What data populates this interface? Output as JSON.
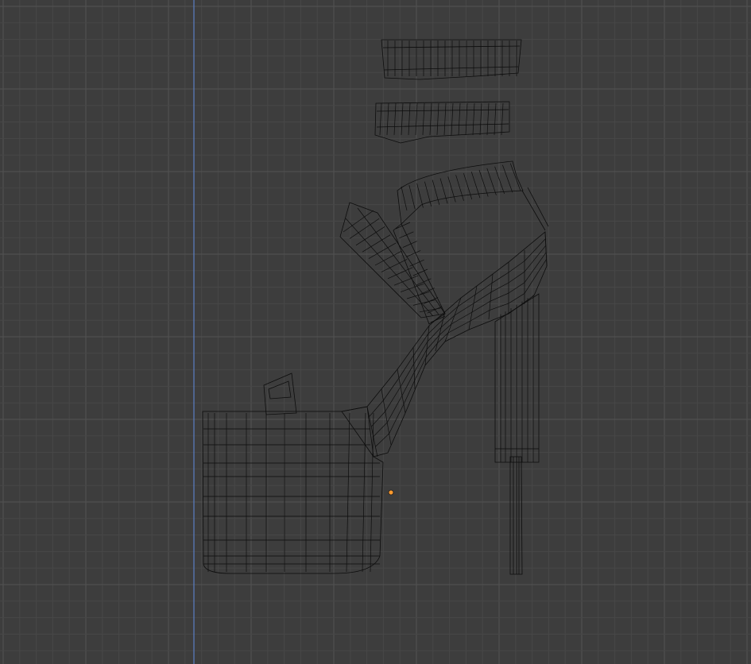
{
  "viewport": {
    "background": "#3d3d3d",
    "grid_minor_color": "#474747",
    "grid_major_color": "#525252",
    "axis_z_color": "#5a7fc4",
    "wire_color": "#0d0d0d",
    "origin_color": "#ff9a2e"
  },
  "model": {
    "parts": [
      "ankle-strap-top",
      "ankle-strap-bottom",
      "instep-strap",
      "toe-strap",
      "toe-loop",
      "platform",
      "sole-arch",
      "heel-shaft",
      "heel-tip"
    ],
    "icons": [
      "origin-dot-icon"
    ]
  }
}
